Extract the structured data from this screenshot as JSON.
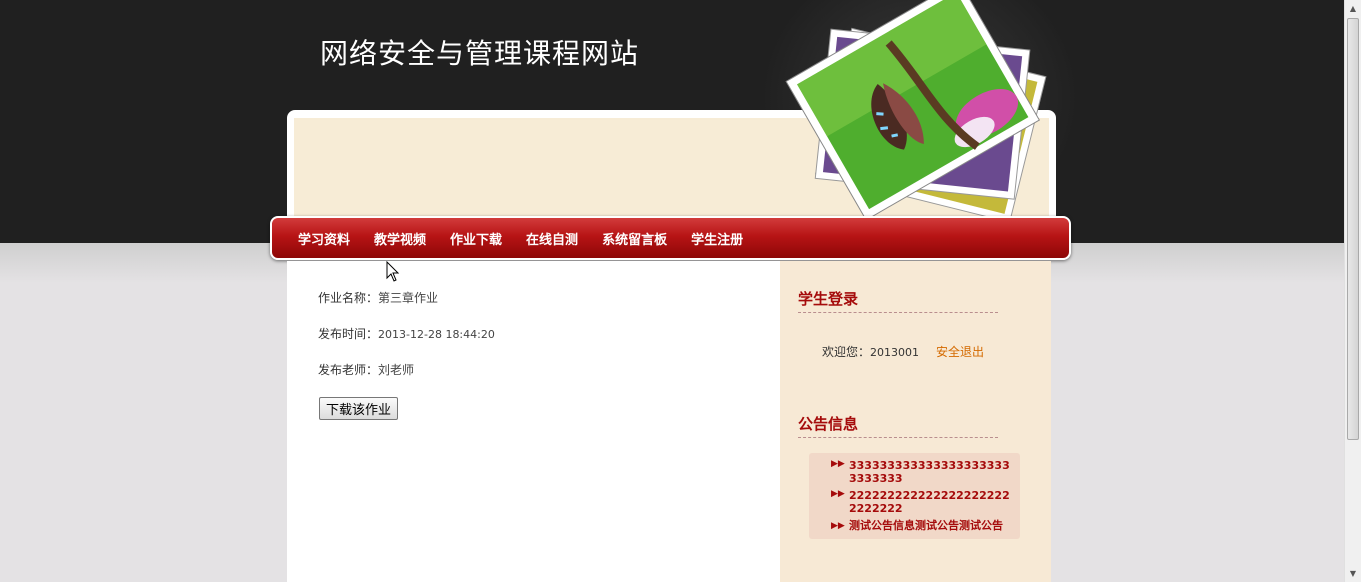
{
  "header": {
    "site_title": "网络安全与管理课程网站"
  },
  "nav": {
    "items": [
      {
        "label": "学习资料"
      },
      {
        "label": "教学视频"
      },
      {
        "label": "作业下载"
      },
      {
        "label": "在线自测"
      },
      {
        "label": "系统留言板"
      },
      {
        "label": "学生注册"
      }
    ]
  },
  "main": {
    "name_label": "作业名称：",
    "name_value": "第三章作业",
    "time_label": "发布时间：",
    "time_value": "2013-12-28 18:44:20",
    "teacher_label": "发布老师：",
    "teacher_value": "刘老师",
    "download_button": "下载该作业"
  },
  "sidebar": {
    "login_heading": "学生登录",
    "welcome_label": "欢迎您：",
    "username": "2013001",
    "logout_link": "安全退出",
    "notice_heading": "公告信息",
    "notices": [
      {
        "text": "3333333333333333333333333333"
      },
      {
        "text": "2222222222222222222222222222"
      },
      {
        "text": "测试公告信息测试公告测试公告"
      }
    ]
  },
  "icons": {
    "notice_arrow": "double-chevron-right-icon",
    "cursor": "mouse-pointer-icon"
  },
  "colors": {
    "nav_red": "#b71415",
    "heading_red": "#a50b0b",
    "link_orange": "#d46a00",
    "sidebar_bg": "#f7e9d5",
    "header_dark": "#202020"
  }
}
